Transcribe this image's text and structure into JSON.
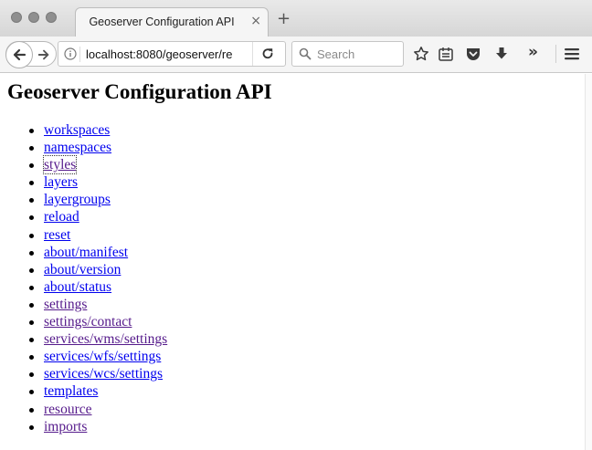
{
  "browser": {
    "tab": {
      "title": "Geoserver Configuration API",
      "close_glyph": "×"
    },
    "new_tab_glyph": "+",
    "url": "localhost:8080/geoserver/re",
    "search_placeholder": "Search",
    "overflow_glyph": "»"
  },
  "page": {
    "title": "Geoserver Configuration API",
    "links": [
      {
        "text": "workspaces",
        "state": "link"
      },
      {
        "text": "namespaces",
        "state": "link"
      },
      {
        "text": "styles",
        "state": "visited-focused"
      },
      {
        "text": "layers",
        "state": "link"
      },
      {
        "text": "layergroups",
        "state": "link"
      },
      {
        "text": "reload",
        "state": "link"
      },
      {
        "text": "reset",
        "state": "link"
      },
      {
        "text": "about/manifest",
        "state": "link"
      },
      {
        "text": "about/version",
        "state": "link"
      },
      {
        "text": "about/status",
        "state": "link"
      },
      {
        "text": "settings",
        "state": "visited"
      },
      {
        "text": "settings/contact",
        "state": "visited"
      },
      {
        "text": "services/wms/settings",
        "state": "visited"
      },
      {
        "text": "services/wfs/settings",
        "state": "link"
      },
      {
        "text": "services/wcs/settings",
        "state": "link"
      },
      {
        "text": "templates",
        "state": "link"
      },
      {
        "text": "resource",
        "state": "visited"
      },
      {
        "text": "imports",
        "state": "visited"
      }
    ]
  },
  "colors": {
    "link": "#0000ee",
    "visited": "#551a8b"
  }
}
